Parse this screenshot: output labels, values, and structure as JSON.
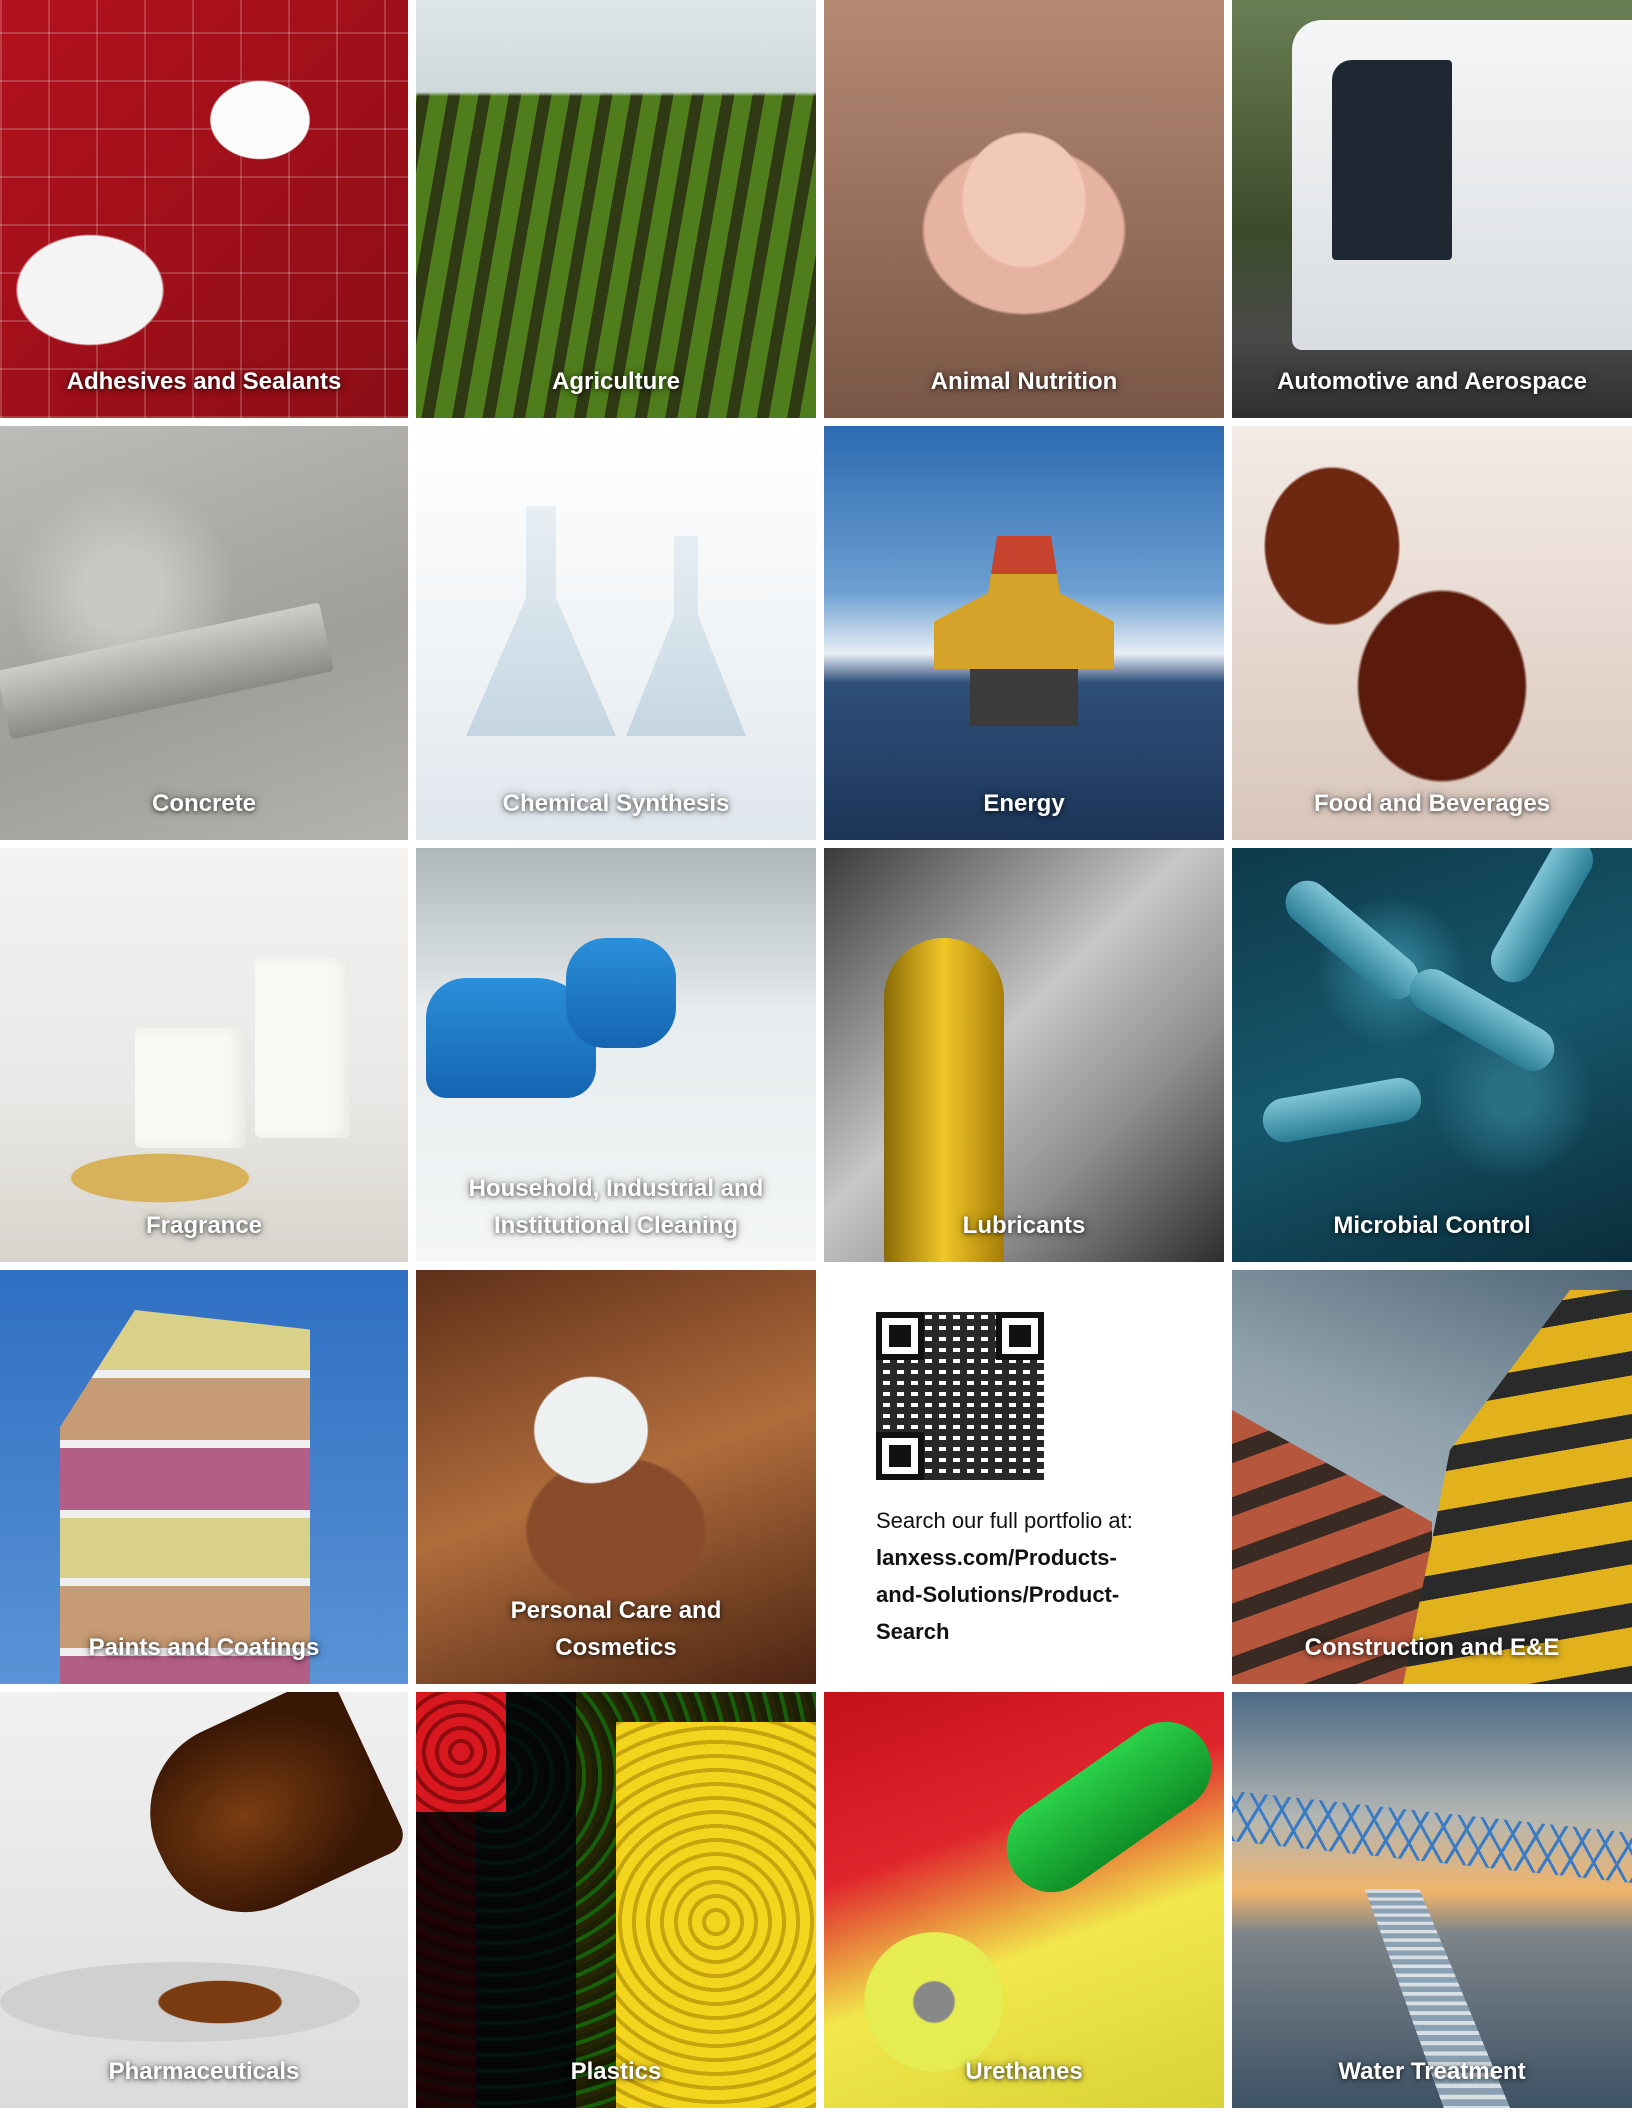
{
  "tiles": [
    {
      "label": "Adhesives and Sealants"
    },
    {
      "label": "Agriculture"
    },
    {
      "label": "Animal Nutrition"
    },
    {
      "label": "Automotive and Aerospace"
    },
    {
      "label": "Concrete"
    },
    {
      "label": "Chemical Synthesis"
    },
    {
      "label": "Energy"
    },
    {
      "label": "Food and Beverages"
    },
    {
      "label": "Fragrance"
    },
    {
      "label_line1": "Household, Industrial and",
      "label_line2": "Institutional Cleaning"
    },
    {
      "label": "Lubricants"
    },
    {
      "label": "Microbial Control"
    },
    {
      "label": "Paints and Coatings"
    },
    {
      "label_line1": "Personal Care and",
      "label_line2": "Cosmetics"
    },
    {
      "label": "Construction and E&E"
    },
    {
      "label": "Pharmaceuticals"
    },
    {
      "label": "Plastics"
    },
    {
      "label": "Urethanes"
    },
    {
      "label": "Water Treatment"
    }
  ],
  "portfolio": {
    "intro": "Search our full portfolio at:",
    "link_line1": "lanxess.com/Products-",
    "link_line2": "and-Solutions/Product-",
    "link_line3": "Search",
    "qr_icon": "qr-code-icon"
  }
}
